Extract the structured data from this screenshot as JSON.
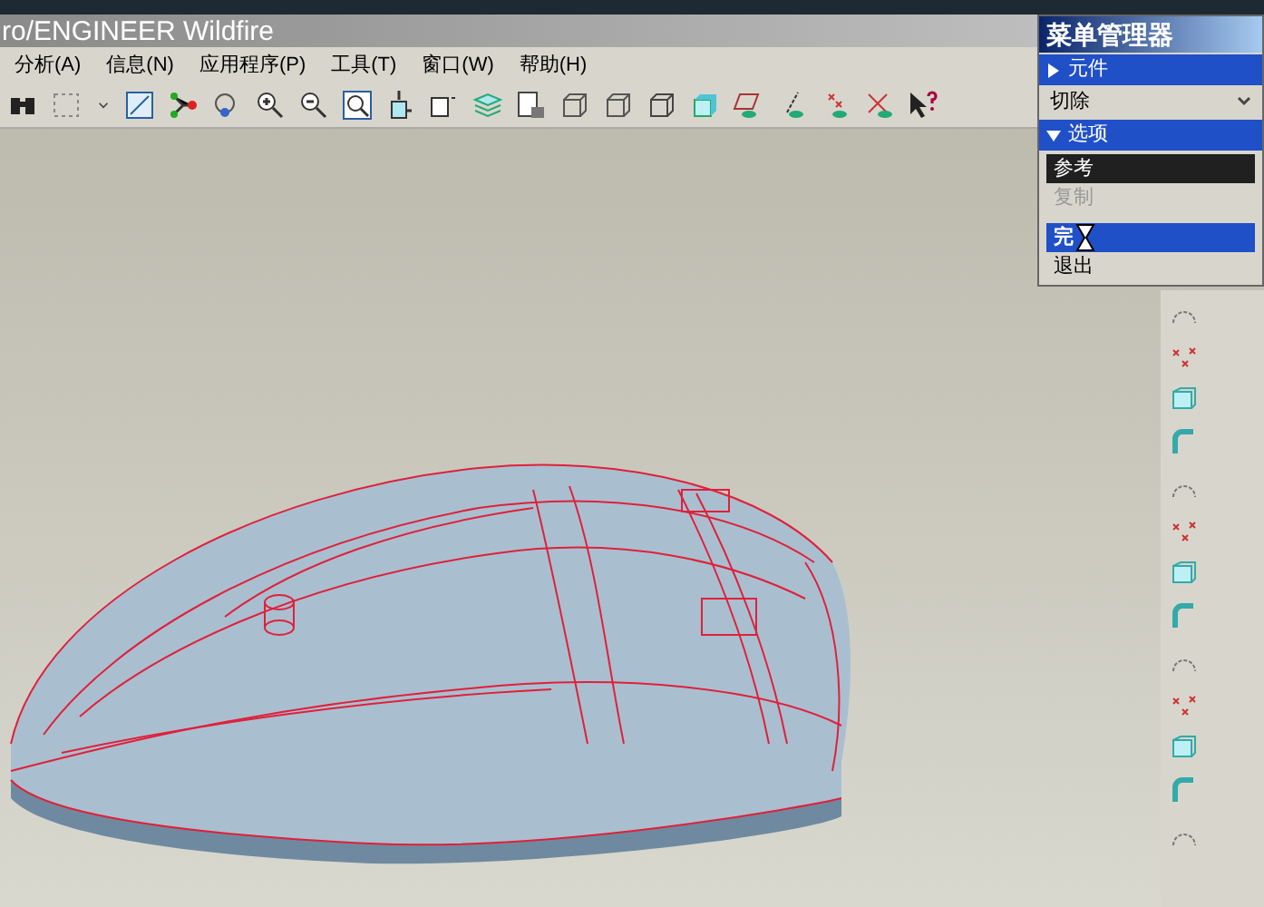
{
  "window": {
    "title": "ro/ENGINEER Wildfire"
  },
  "menu": [
    {
      "label": "分析(A)"
    },
    {
      "label": "信息(N)"
    },
    {
      "label": "应用程序(P)"
    },
    {
      "label": "工具(T)"
    },
    {
      "label": "窗口(W)"
    },
    {
      "label": "帮助(H)"
    }
  ],
  "menu_manager": {
    "title": "菜单管理器",
    "sections": [
      {
        "label": "元件",
        "expanded": false,
        "dropdown": "切除"
      },
      {
        "label": "选项",
        "expanded": true,
        "items": [
          {
            "label": "参考",
            "checked": true,
            "selected": false,
            "disabled": false
          },
          {
            "label": "复制",
            "checked": false,
            "selected": false,
            "disabled": true
          },
          {
            "label": "完",
            "checked": false,
            "selected": true,
            "disabled": false
          },
          {
            "label": "退出",
            "checked": false,
            "selected": false,
            "disabled": false
          }
        ]
      }
    ]
  }
}
